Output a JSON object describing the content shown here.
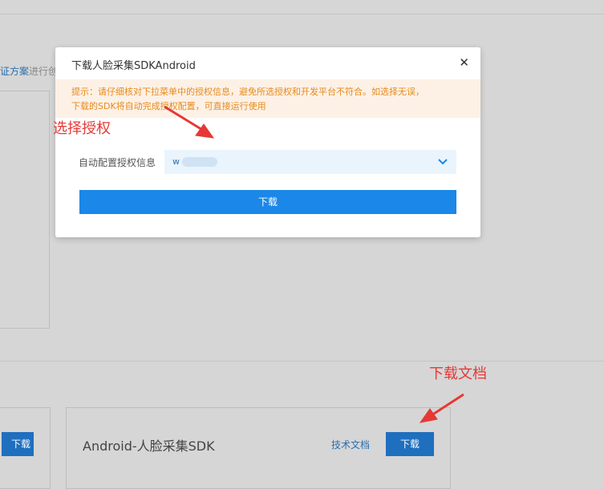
{
  "background": {
    "link_fragment": "证方案",
    "link_suffix": "进行创",
    "left_card_button": "下载",
    "sdk_card": {
      "title": "Android-人脸采集SDK",
      "doc_link": "技术文档",
      "download": "下载"
    }
  },
  "modal": {
    "title": "下载人脸采集SDKAndroid",
    "tip_line1": "提示：请仔细核对下拉菜单中的授权信息，避免所选授权和开发平台不符合。如选择无误，",
    "tip_line2": "下载的SDK将自动完成授权配置，可直接运行使用",
    "field_label": "自动配置授权信息",
    "select_value": "w",
    "download_button": "下载"
  },
  "annotations": {
    "select_auth": "选择授权",
    "download_docs": "下载文档"
  },
  "colors": {
    "primary": "#1b87e8",
    "tip_text": "#e78a1b",
    "tip_bg": "#fdf1e6",
    "annotation": "#e53935"
  }
}
